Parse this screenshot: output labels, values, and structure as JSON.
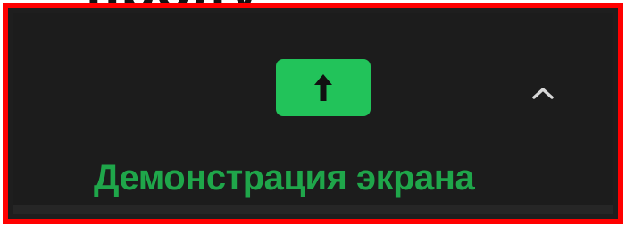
{
  "header_fragment": "проду",
  "toolbar": {
    "share_button": {
      "icon": "arrow-up-icon",
      "label": "Демонстрация экрана",
      "accent_color": "#22c35a",
      "label_color": "#1fa64a"
    },
    "options_chevron": {
      "icon": "chevron-up-icon"
    },
    "background_color": "#1c1c1c"
  },
  "frame_color": "#ff0000"
}
